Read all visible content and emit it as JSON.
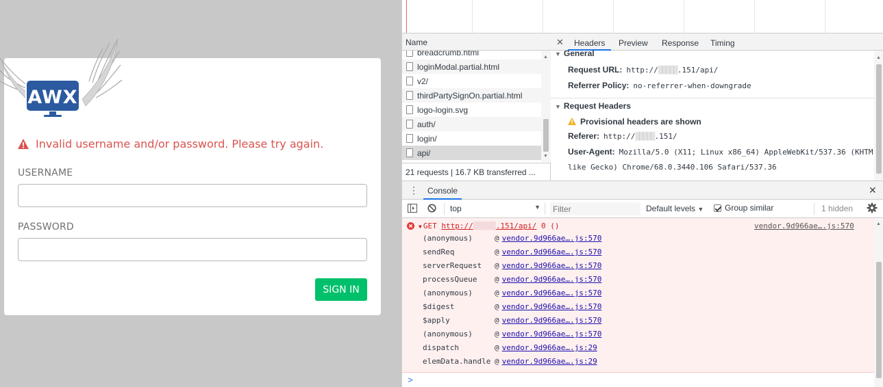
{
  "login": {
    "error_message": "Invalid username and/or password. Please try again.",
    "username_label": "USERNAME",
    "username_value": "",
    "password_label": "PASSWORD",
    "password_value": "",
    "signin_label": "SIGN IN",
    "logo_text": "AWX",
    "colors": {
      "error": "#d9534f",
      "button": "#00c06b",
      "logo": "#2c5aa0"
    }
  },
  "network": {
    "name_header": "Name",
    "requests": [
      "breadcrumb.html",
      "loginModal.partial.html",
      "v2/",
      "thirdPartySignOn.partial.html",
      "logo-login.svg",
      "auth/",
      "login/",
      "api/"
    ],
    "status": "21 requests  |  16.7 KB transferred  ..."
  },
  "headers_panel": {
    "tabs": [
      "Headers",
      "Preview",
      "Response",
      "Timing"
    ],
    "general_title": "General",
    "request_url_key": "Request URL:",
    "request_url_val": "http://",
    "request_url_tail": ".151/api/",
    "referrer_policy_key": "Referrer Policy:",
    "referrer_policy_val": "no-referrer-when-downgrade",
    "request_headers_title": "Request Headers",
    "provisional_warning": "Provisional headers are shown",
    "referer_key": "Referer:",
    "referer_val": "http://",
    "referer_tail": ".151/",
    "user_agent_key": "User-Agent:",
    "user_agent_val": "Mozilla/5.0 (X11; Linux x86_64) AppleWebKit/537.36 (KHTM",
    "user_agent_cont": "like Gecko) Chrome/68.0.3440.106 Safari/537.36"
  },
  "console": {
    "tab_label": "Console",
    "context": "top",
    "filter_placeholder": "Filter",
    "levels": "Default levels",
    "group_similar": "Group similar",
    "hidden_count": "1 hidden",
    "error": {
      "method": "GET",
      "url_prefix": "http://",
      "url_tail": ".151/api/",
      "status": "0 ()",
      "source": "vendor.9d966ae….js:570"
    },
    "stack": [
      {
        "fn": "(anonymous)",
        "link": "vendor.9d966ae….js:570"
      },
      {
        "fn": "sendReq",
        "link": "vendor.9d966ae….js:570"
      },
      {
        "fn": "serverRequest",
        "link": "vendor.9d966ae….js:570"
      },
      {
        "fn": "processQueue",
        "link": "vendor.9d966ae….js:570"
      },
      {
        "fn": "(anonymous)",
        "link": "vendor.9d966ae….js:570"
      },
      {
        "fn": "$digest",
        "link": "vendor.9d966ae….js:570"
      },
      {
        "fn": "$apply",
        "link": "vendor.9d966ae….js:570"
      },
      {
        "fn": "(anonymous)",
        "link": "vendor.9d966ae….js:570"
      },
      {
        "fn": "dispatch",
        "link": "vendor.9d966ae….js:29"
      },
      {
        "fn": "elemData.handle",
        "link": "vendor.9d966ae….js:29"
      }
    ],
    "prompt": ">"
  }
}
